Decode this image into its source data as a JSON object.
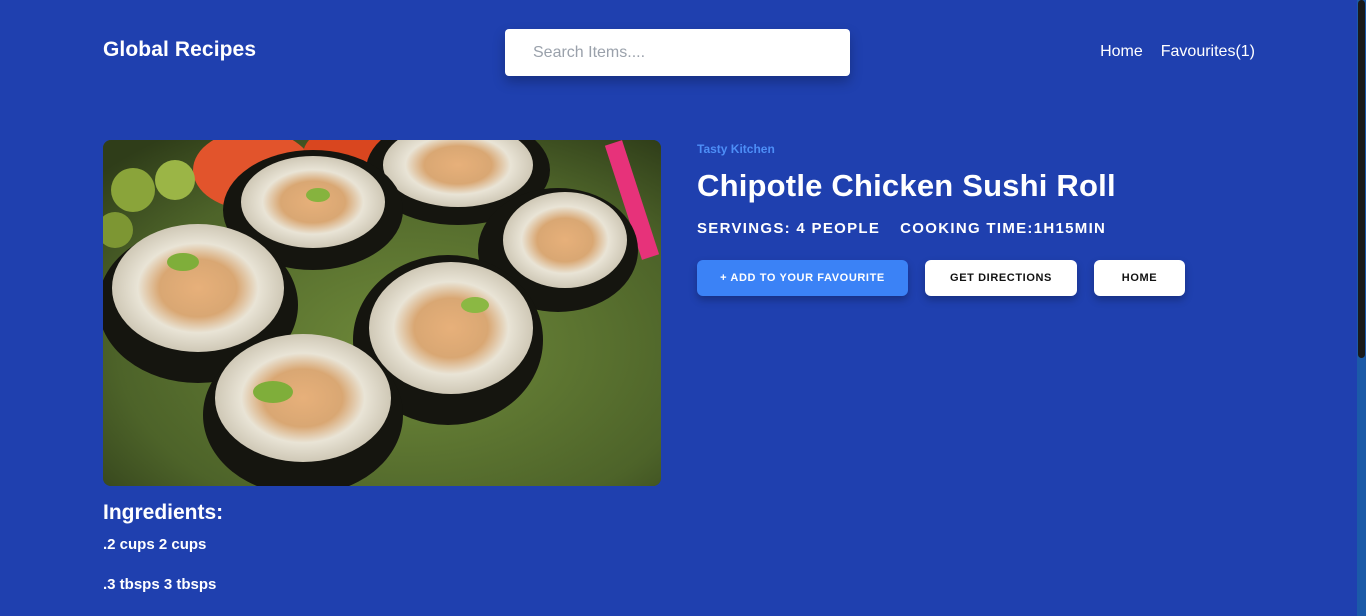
{
  "header": {
    "brand": "Global Recipes",
    "search_placeholder": "Search Items....",
    "search_value": "",
    "nav": {
      "home": "Home",
      "favourites": "Favourites(1)"
    }
  },
  "recipe": {
    "publisher": "Tasty Kitchen",
    "title": "Chipotle Chicken Sushi Roll",
    "servings": "SERVINGS: 4 PEOPLE",
    "cooking_time": "COOKING TIME:1H15MIN",
    "image_subject": "sushi rolls on a green plate"
  },
  "actions": {
    "add_favourite": "+ ADD TO YOUR FAVOURITE",
    "directions": "GET DIRECTIONS",
    "home": "HOME"
  },
  "ingredients": {
    "heading": "Ingredients:",
    "items": [
      ".2 cups 2 cups",
      ".3 tbsps 3 tbsps"
    ]
  },
  "colors": {
    "background": "#1f40af",
    "primary_button": "#3b82f6",
    "publisher_text": "#4d8ef7"
  }
}
